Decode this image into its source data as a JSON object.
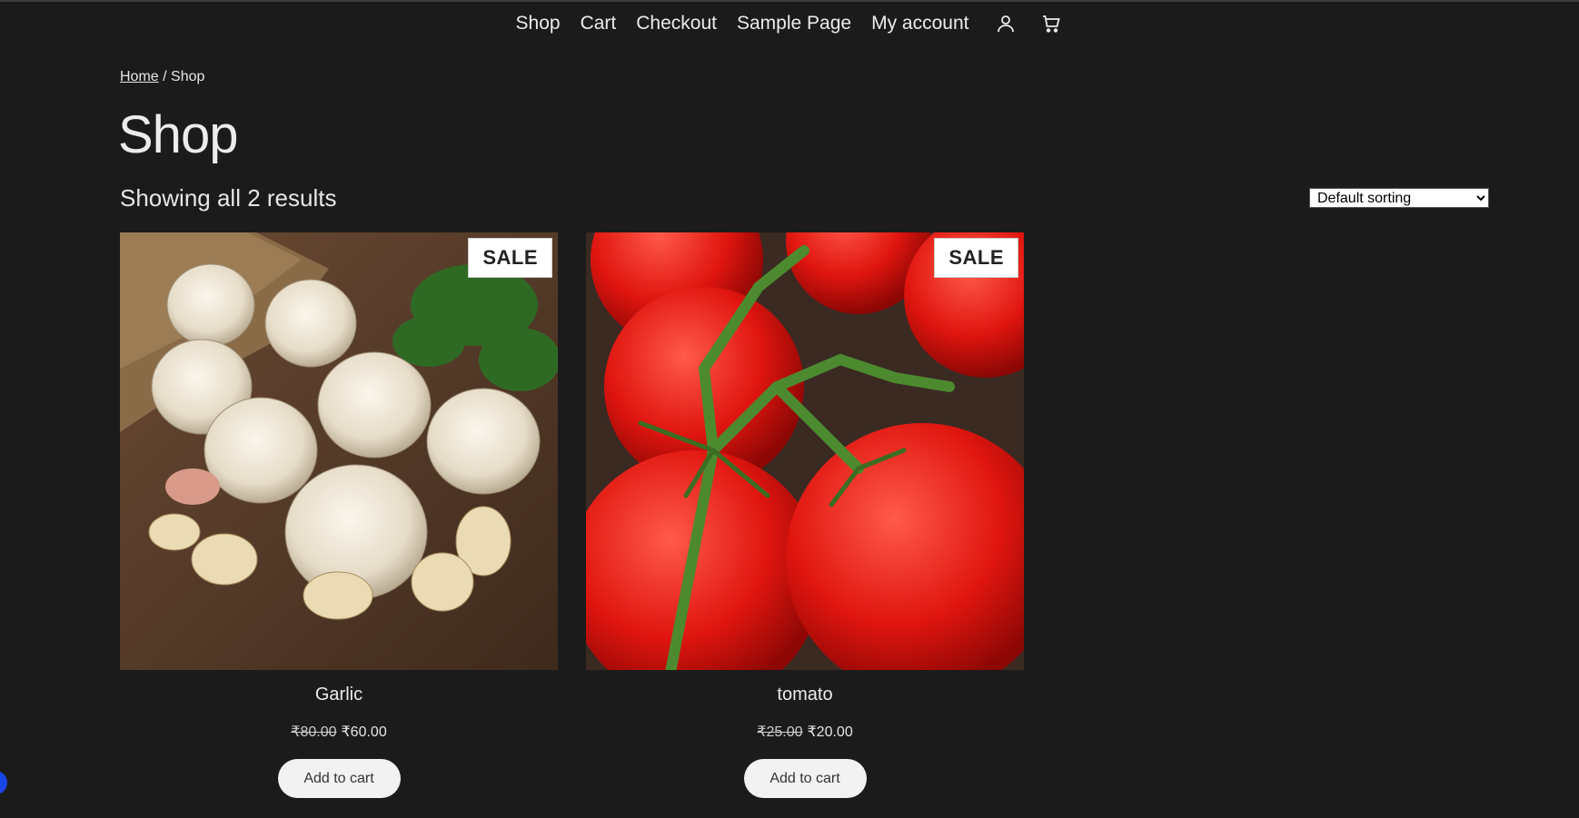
{
  "nav": {
    "items": [
      "Shop",
      "Cart",
      "Checkout",
      "Sample Page",
      "My account"
    ],
    "icons": [
      "user-icon",
      "cart-icon"
    ]
  },
  "breadcrumb": {
    "home": "Home",
    "separator": " / ",
    "current": "Shop"
  },
  "page": {
    "title": "Shop",
    "result_count": "Showing all 2 results"
  },
  "sorting": {
    "selected": "Default sorting"
  },
  "products": [
    {
      "name": "Garlic",
      "badge": "SALE",
      "old_price": "₹80.00",
      "price": "₹60.00",
      "button": "Add to cart"
    },
    {
      "name": "tomato",
      "badge": "SALE",
      "old_price": "₹25.00",
      "price": "₹20.00",
      "button": "Add to cart"
    }
  ],
  "colors": {
    "background": "#1b1b1b",
    "text": "#ececec",
    "button_bg": "#f2f2f2",
    "accent_dot": "#1a45e6"
  }
}
